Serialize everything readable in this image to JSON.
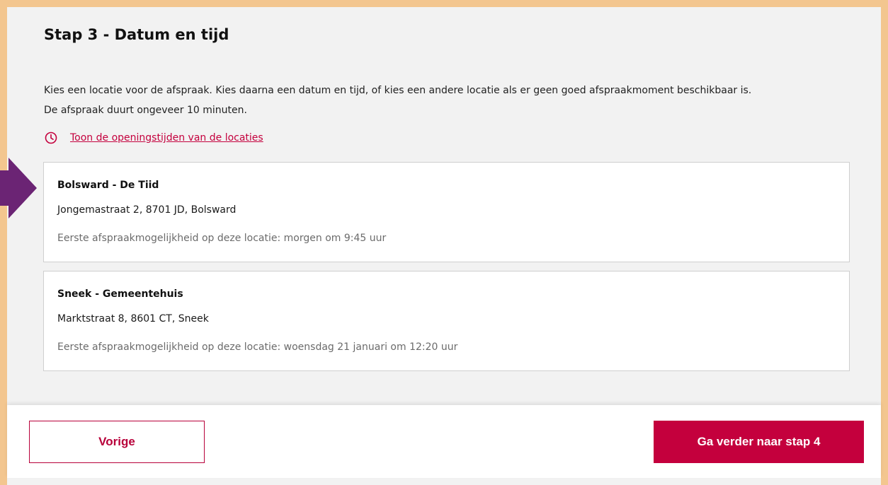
{
  "step": {
    "title": "Stap 3 - Datum en tijd",
    "intro_line1": "Kies een locatie voor de afspraak. Kies daarna een datum en tijd, of kies een andere locatie als er geen goed afspraakmoment beschikbaar is.",
    "intro_line2": "De afspraak duurt ongeveer 10 minuten."
  },
  "hours_link": {
    "icon": "clock-icon",
    "label": "Toon de openingstijden van de locaties"
  },
  "locations": [
    {
      "name": "Bolsward - De Tiid",
      "address": "Jongemastraat 2, 8701 JD, Bolsward",
      "availability": "Eerste afspraakmogelijkheid op deze locatie: morgen om 9:45 uur"
    },
    {
      "name": "Sneek - Gemeentehuis",
      "address": "Marktstraat 8, 8601 CT, Sneek",
      "availability": "Eerste afspraakmogelijkheid op deze locatie: woensdag 21 januari om 12:20 uur"
    }
  ],
  "footer": {
    "prev_label": "Vorige",
    "next_label": "Ga verder naar stap 4"
  },
  "colors": {
    "accent": "#c4003d",
    "frame": "#f3c68f",
    "arrow": "#6b2474",
    "panel": "#f2f2f2"
  }
}
